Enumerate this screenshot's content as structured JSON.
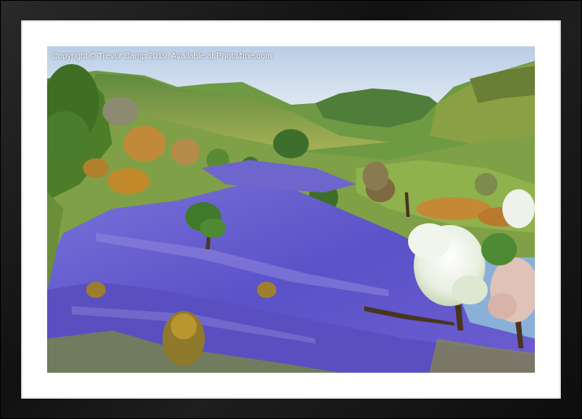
{
  "image": {
    "watermark": "Copyright  © Trevor Camp  2019. Available at Photo4me.com",
    "frame_color": "#1a1a1a",
    "mount_color": "#ffffff"
  }
}
